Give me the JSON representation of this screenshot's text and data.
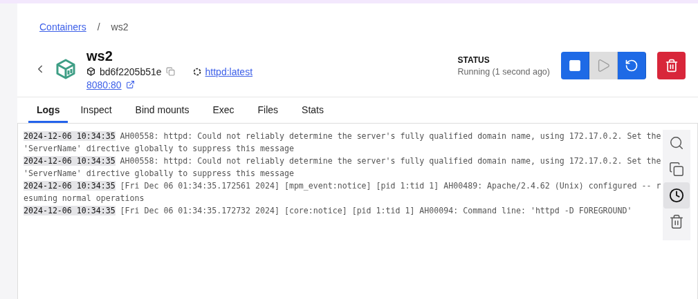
{
  "breadcrumb": {
    "link": "Containers",
    "separator": "/",
    "current": "ws2"
  },
  "container": {
    "name": "ws2",
    "id": "bd6f2205b51e",
    "image": "httpd:latest",
    "port": "8080:80"
  },
  "status": {
    "label": "STATUS",
    "text": "Running (1 second ago)"
  },
  "actions": [
    {
      "kind": "stop",
      "disabled": false
    },
    {
      "kind": "start",
      "disabled": true
    },
    {
      "kind": "restart",
      "disabled": false
    },
    {
      "kind": "delete",
      "disabled": false
    }
  ],
  "tabs": [
    {
      "label": "Logs",
      "selected": true
    },
    {
      "label": "Inspect",
      "selected": false
    },
    {
      "label": "Bind mounts",
      "selected": false
    },
    {
      "label": "Exec",
      "selected": false
    },
    {
      "label": "Files",
      "selected": false
    },
    {
      "label": "Stats",
      "selected": false
    }
  ],
  "logs": [
    {
      "time": "2024-12-06 10:34:35",
      "message": "AH00558: httpd: Could not reliably determine the server's fully qualified domain name, using 172.17.0.2. Set the 'ServerName' directive globally to suppress this message"
    },
    {
      "time": "2024-12-06 10:34:35",
      "message": "AH00558: httpd: Could not reliably determine the server's fully qualified domain name, using 172.17.0.2. Set the 'ServerName' directive globally to suppress this message"
    },
    {
      "time": "2024-12-06 10:34:35",
      "message": "[Fri Dec 06 01:34:35.172561 2024] [mpm_event:notice] [pid 1:tid 1] AH00489: Apache/2.4.62 (Unix) configured -- resuming normal operations"
    },
    {
      "time": "2024-12-06 10:34:35",
      "message": "[Fri Dec 06 01:34:35.172732 2024] [core:notice] [pid 1:tid 1] AH00094: Command line: 'httpd -D FOREGROUND'"
    }
  ],
  "log_tools": [
    {
      "kind": "search",
      "selected": false
    },
    {
      "kind": "copy",
      "selected": false
    },
    {
      "kind": "timestamps",
      "selected": true
    },
    {
      "kind": "clear",
      "selected": false
    }
  ]
}
